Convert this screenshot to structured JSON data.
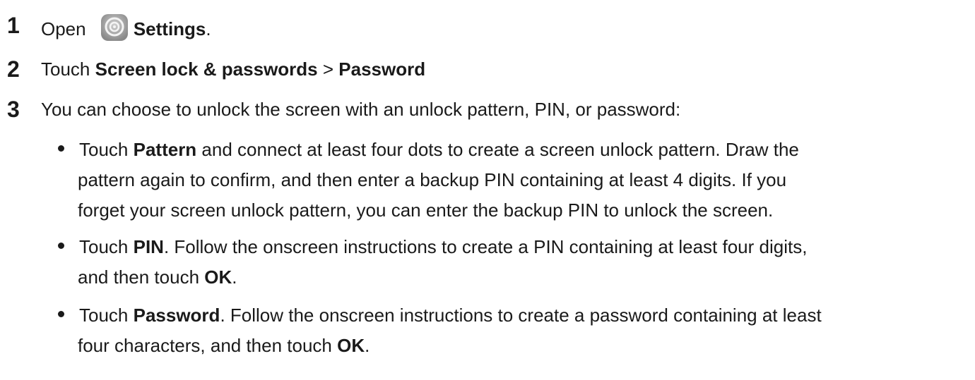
{
  "steps": [
    {
      "num": "1",
      "pre": "Open ",
      "bold": "Settings",
      "post": ".",
      "icon": "settings-icon"
    },
    {
      "num": "2",
      "pre": "Touch ",
      "bold1": "Screen lock & passwords",
      "sep": " > ",
      "bold2": "Password"
    },
    {
      "num": "3",
      "text": "You can choose to unlock the screen with an unlock pattern, PIN, or password:"
    }
  ],
  "bullets": [
    {
      "pre": "Touch ",
      "bold": "Pattern",
      "post": " and connect at least four dots to create a screen unlock pattern. Draw the",
      "line2": "pattern again to confirm, and then enter a backup PIN containing at least 4 digits. If you",
      "line3": "forget your screen unlock pattern, you can enter the backup PIN to unlock the screen."
    },
    {
      "pre": "Touch ",
      "bold": "PIN",
      "post": ". Follow the onscreen instructions to create a PIN containing at least four digits,",
      "line2_pre": "and then touch ",
      "line2_bold": "OK",
      "line2_post": "."
    },
    {
      "pre": "Touch ",
      "bold": "Password",
      "post": ". Follow the onscreen instructions to create a password containing at least",
      "line2_pre": "four characters, and then touch ",
      "line2_bold": "OK",
      "line2_post": "."
    }
  ],
  "colors": {
    "text": "#1a1a1a",
    "icon_bg": "#9a9a9a"
  }
}
